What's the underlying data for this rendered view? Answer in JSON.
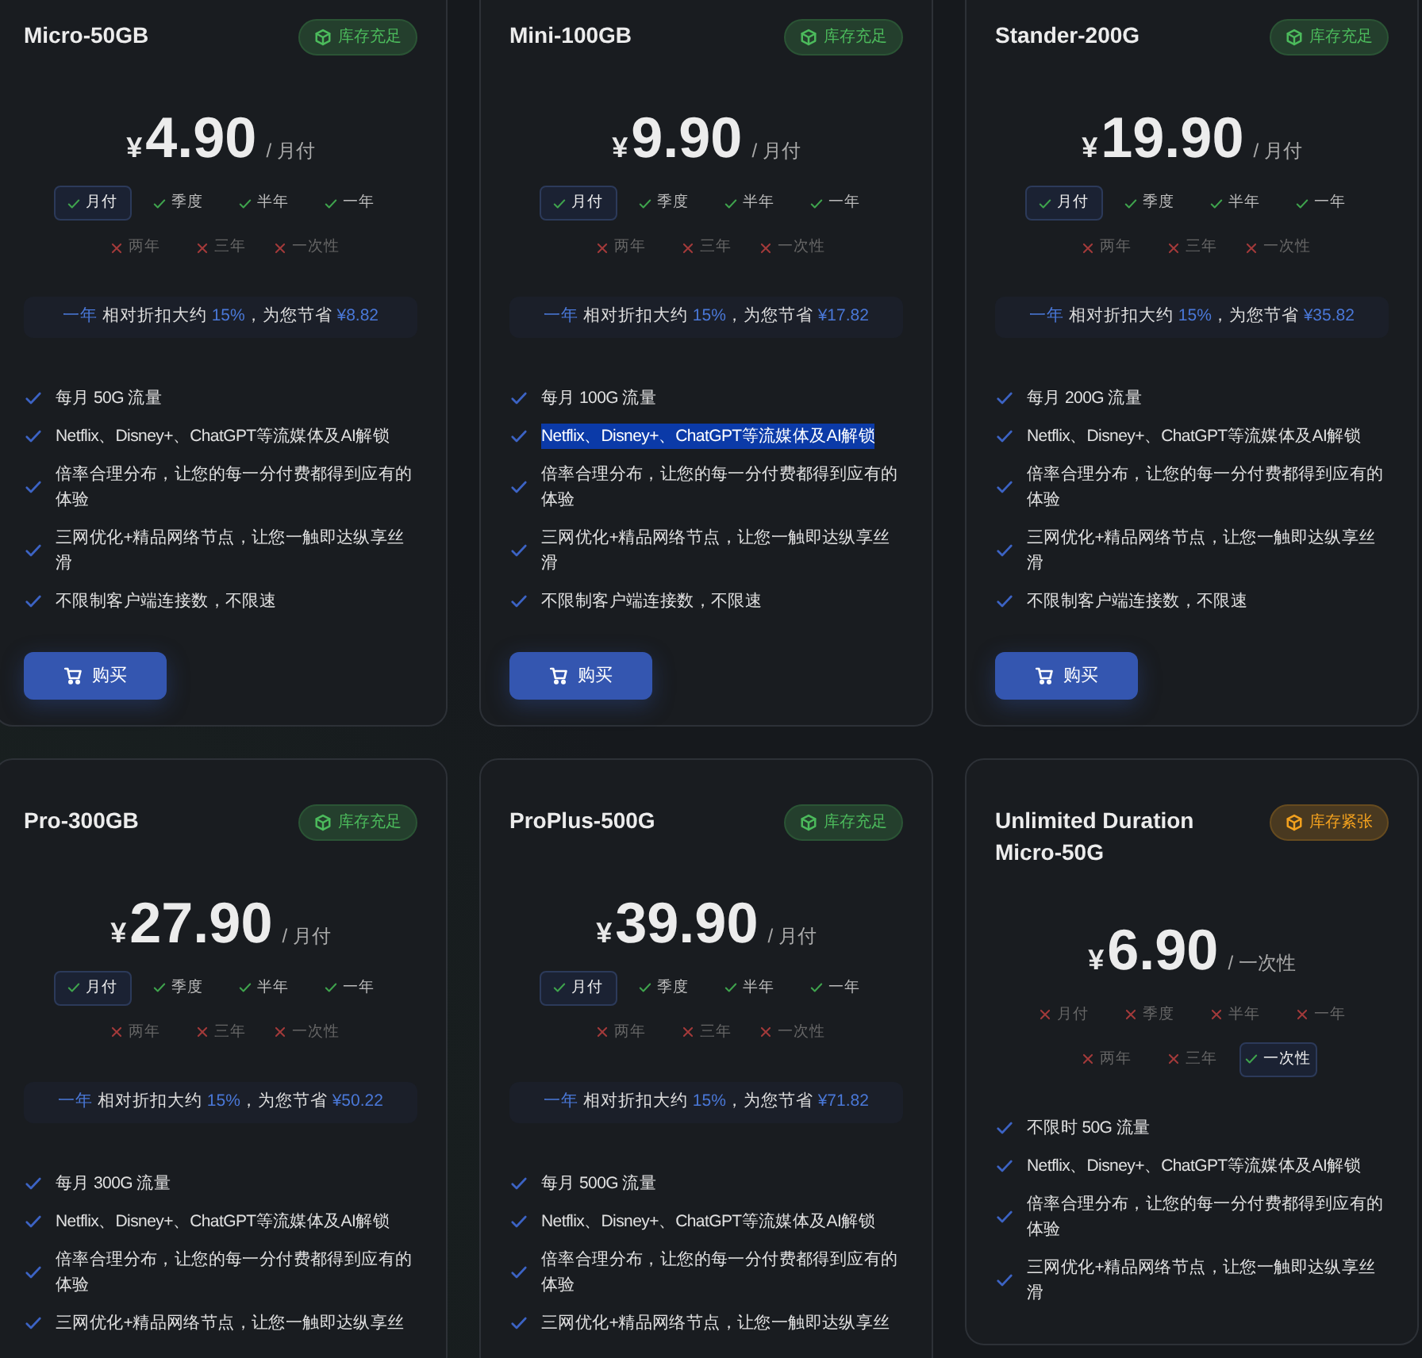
{
  "plans": [
    {
      "name": "Micro-50GB",
      "stock": {
        "label": "库存充足",
        "color": "#4cbb5c"
      },
      "price": {
        "currency": "¥",
        "amount": "4.90",
        "unit": "/ 月付"
      },
      "periods": [
        {
          "label": "月付",
          "available": true,
          "selected": true
        },
        {
          "label": "季度",
          "available": true,
          "selected": false
        },
        {
          "label": "半年",
          "available": true,
          "selected": false
        },
        {
          "label": "一年",
          "available": true,
          "selected": false
        },
        {
          "label": "两年",
          "available": false,
          "selected": false
        },
        {
          "label": "三年",
          "available": false,
          "selected": false
        },
        {
          "label": "一次性",
          "available": false,
          "selected": false
        }
      ],
      "savings": {
        "period": "一年",
        "text_1": " 相对折扣大约 ",
        "percent": "15%",
        "text_2": "，为您节省 ",
        "amount": "¥8.82"
      },
      "features": [
        {
          "text": "每月 50G 流量",
          "highlighted": false
        },
        {
          "text": "Netflix、Disney+、ChatGPT等流媒体及AI解锁",
          "highlighted": false
        },
        {
          "text": "倍率合理分布，让您的每一分付费都得到应有的体验",
          "highlighted": false
        },
        {
          "text": "三网优化+精品网络节点，让您一触即达纵享丝滑",
          "highlighted": false
        },
        {
          "text": "不限制客户端连接数，不限速",
          "highlighted": false
        }
      ],
      "button": "购买"
    },
    {
      "name": "Mini-100GB",
      "stock": {
        "label": "库存充足",
        "color": "#4cbb5c"
      },
      "price": {
        "currency": "¥",
        "amount": "9.90",
        "unit": "/ 月付"
      },
      "periods": [
        {
          "label": "月付",
          "available": true,
          "selected": true
        },
        {
          "label": "季度",
          "available": true,
          "selected": false
        },
        {
          "label": "半年",
          "available": true,
          "selected": false
        },
        {
          "label": "一年",
          "available": true,
          "selected": false
        },
        {
          "label": "两年",
          "available": false,
          "selected": false
        },
        {
          "label": "三年",
          "available": false,
          "selected": false
        },
        {
          "label": "一次性",
          "available": false,
          "selected": false
        }
      ],
      "savings": {
        "period": "一年",
        "text_1": " 相对折扣大约 ",
        "percent": "15%",
        "text_2": "，为您节省 ",
        "amount": "¥17.82"
      },
      "features": [
        {
          "text": "每月 100G 流量",
          "highlighted": false
        },
        {
          "text": "Netflix、Disney+、ChatGPT等流媒体及AI解锁",
          "highlighted": true
        },
        {
          "text": "倍率合理分布，让您的每一分付费都得到应有的体验",
          "highlighted": false
        },
        {
          "text": "三网优化+精品网络节点，让您一触即达纵享丝滑",
          "highlighted": false
        },
        {
          "text": "不限制客户端连接数，不限速",
          "highlighted": false
        }
      ],
      "button": "购买"
    },
    {
      "name": "Stander-200G",
      "stock": {
        "label": "库存充足",
        "color": "#4cbb5c"
      },
      "price": {
        "currency": "¥",
        "amount": "19.90",
        "unit": "/ 月付"
      },
      "periods": [
        {
          "label": "月付",
          "available": true,
          "selected": true
        },
        {
          "label": "季度",
          "available": true,
          "selected": false
        },
        {
          "label": "半年",
          "available": true,
          "selected": false
        },
        {
          "label": "一年",
          "available": true,
          "selected": false
        },
        {
          "label": "两年",
          "available": false,
          "selected": false
        },
        {
          "label": "三年",
          "available": false,
          "selected": false
        },
        {
          "label": "一次性",
          "available": false,
          "selected": false
        }
      ],
      "savings": {
        "period": "一年",
        "text_1": " 相对折扣大约 ",
        "percent": "15%",
        "text_2": "，为您节省 ",
        "amount": "¥35.82"
      },
      "features": [
        {
          "text": "每月 200G 流量",
          "highlighted": false
        },
        {
          "text": "Netflix、Disney+、ChatGPT等流媒体及AI解锁",
          "highlighted": false
        },
        {
          "text": "倍率合理分布，让您的每一分付费都得到应有的体验",
          "highlighted": false
        },
        {
          "text": "三网优化+精品网络节点，让您一触即达纵享丝滑",
          "highlighted": false
        },
        {
          "text": "不限制客户端连接数，不限速",
          "highlighted": false
        }
      ],
      "button": "购买"
    },
    {
      "name": "Pro-300GB",
      "stock": {
        "label": "库存充足",
        "color": "#4cbb5c"
      },
      "price": {
        "currency": "¥",
        "amount": "27.90",
        "unit": "/ 月付"
      },
      "periods": [
        {
          "label": "月付",
          "available": true,
          "selected": true
        },
        {
          "label": "季度",
          "available": true,
          "selected": false
        },
        {
          "label": "半年",
          "available": true,
          "selected": false
        },
        {
          "label": "一年",
          "available": true,
          "selected": false
        },
        {
          "label": "两年",
          "available": false,
          "selected": false
        },
        {
          "label": "三年",
          "available": false,
          "selected": false
        },
        {
          "label": "一次性",
          "available": false,
          "selected": false
        }
      ],
      "savings": {
        "period": "一年",
        "text_1": " 相对折扣大约 ",
        "percent": "15%",
        "text_2": "，为您节省 ",
        "amount": "¥50.22"
      },
      "features": [
        {
          "text": "每月 300G 流量",
          "highlighted": false
        },
        {
          "text": "Netflix、Disney+、ChatGPT等流媒体及AI解锁",
          "highlighted": false
        },
        {
          "text": "倍率合理分布，让您的每一分付费都得到应有的体验",
          "highlighted": false
        },
        {
          "text": "三网优化+精品网络节点，让您一触即达纵享丝",
          "highlighted": false
        }
      ]
    },
    {
      "name": "ProPlus-500G",
      "stock": {
        "label": "库存充足",
        "color": "#4cbb5c"
      },
      "price": {
        "currency": "¥",
        "amount": "39.90",
        "unit": "/ 月付"
      },
      "periods": [
        {
          "label": "月付",
          "available": true,
          "selected": true
        },
        {
          "label": "季度",
          "available": true,
          "selected": false
        },
        {
          "label": "半年",
          "available": true,
          "selected": false
        },
        {
          "label": "一年",
          "available": true,
          "selected": false
        },
        {
          "label": "两年",
          "available": false,
          "selected": false
        },
        {
          "label": "三年",
          "available": false,
          "selected": false
        },
        {
          "label": "一次性",
          "available": false,
          "selected": false
        }
      ],
      "savings": {
        "period": "一年",
        "text_1": " 相对折扣大约 ",
        "percent": "15%",
        "text_2": "，为您节省 ",
        "amount": "¥71.82"
      },
      "features": [
        {
          "text": "每月 500G 流量",
          "highlighted": false
        },
        {
          "text": "Netflix、Disney+、ChatGPT等流媒体及AI解锁",
          "highlighted": false
        },
        {
          "text": "倍率合理分布，让您的每一分付费都得到应有的体验",
          "highlighted": false
        },
        {
          "text": "三网优化+精品网络节点，让您一触即达纵享丝",
          "highlighted": false
        }
      ]
    },
    {
      "name": "Unlimited Duration Micro-50G",
      "stock": {
        "label": "库存紧张",
        "color": "#f4a21e"
      },
      "price": {
        "currency": "¥",
        "amount": "6.90",
        "unit": "/ 一次性"
      },
      "periods": [
        {
          "label": "月付",
          "available": false,
          "selected": false
        },
        {
          "label": "季度",
          "available": false,
          "selected": false
        },
        {
          "label": "半年",
          "available": false,
          "selected": false
        },
        {
          "label": "一年",
          "available": false,
          "selected": false
        },
        {
          "label": "两年",
          "available": false,
          "selected": false
        },
        {
          "label": "三年",
          "available": false,
          "selected": false
        },
        {
          "label": "一次性",
          "available": true,
          "selected": true
        }
      ],
      "features": [
        {
          "text": "不限时 50G 流量",
          "highlighted": false
        },
        {
          "text": "Netflix、Disney+、ChatGPT等流媒体及AI解锁",
          "highlighted": false
        },
        {
          "text": "倍率合理分布，让您的每一分付费都得到应有的体验",
          "highlighted": false
        },
        {
          "text": "三网优化+精品网络节点，让您一触即达纵享丝滑",
          "highlighted": false
        }
      ]
    }
  ]
}
